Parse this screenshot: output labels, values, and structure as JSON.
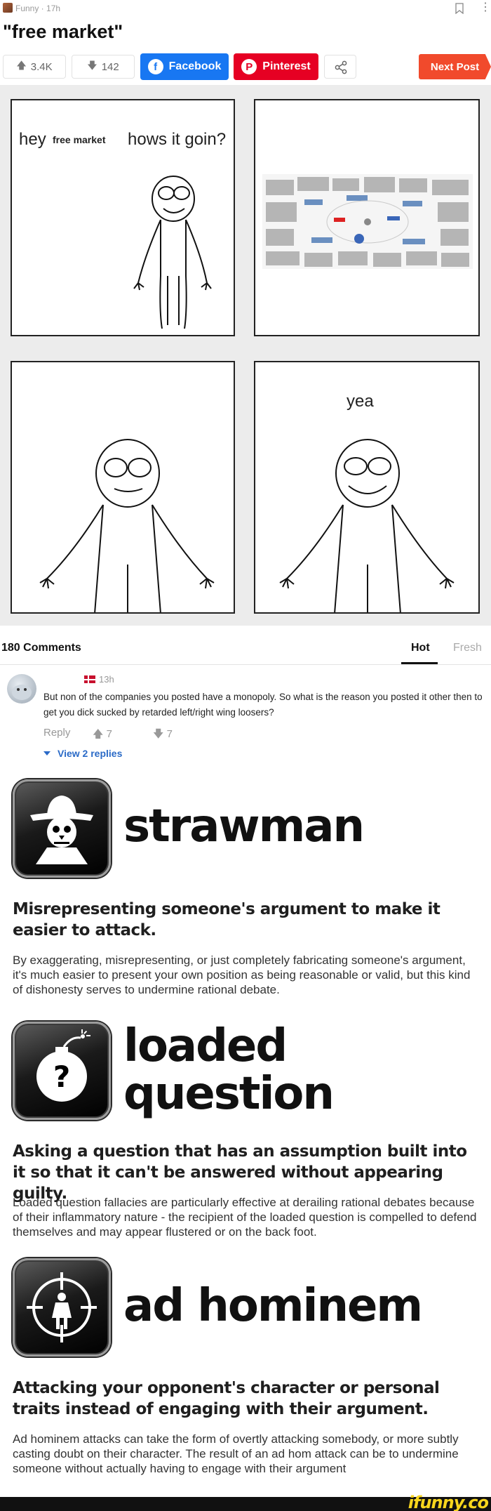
{
  "header": {
    "meta": "Funny · 17h",
    "title": "\"free market\""
  },
  "actions": {
    "upvotes": "3.4K",
    "downvotes": "142",
    "facebook": "Facebook",
    "pinterest": "Pinterest",
    "next_post": "Next Post",
    "colors": {
      "facebook": "#1877f2",
      "pinterest": "#e60023",
      "next": "#f14a2c"
    }
  },
  "comic": {
    "panel1_text_a": "hey",
    "panel1_text_b": "free market",
    "panel1_text_c": "hows it goin?",
    "panel4_text": "yea"
  },
  "comments": {
    "count_label": "180 Comments",
    "tab_hot": "Hot",
    "tab_fresh": "Fresh",
    "first": {
      "time": "13h",
      "text": "But non of the companies you posted have a monopoly. So what is the reason you posted it other then to get you dick sucked by retarded left/right wing loosers?",
      "reply": "Reply",
      "up": "7",
      "down": "7",
      "view_replies": "View 2 replies"
    }
  },
  "fallacies": [
    {
      "name": "strawman",
      "icon": "scarecrow-icon",
      "subtitle": "Misrepresenting someone's argument to make it easier to attack.",
      "description": "By exaggerating, misrepresenting, or just completely fabricating someone's argument, it's much easier to present your own position as being reasonable or valid, but this kind of dishonesty serves to undermine rational debate."
    },
    {
      "name_line1": "loaded",
      "name_line2": "question",
      "icon": "bomb-question-icon",
      "subtitle": "Asking a question that has an assumption built into it so that it can't be answered without appearing guilty.",
      "description": "Loaded question fallacies are particularly effective at derailing rational debates because of their inflammatory nature - the recipient of the loaded question is compelled to defend themselves and may appear flustered or on the back foot."
    },
    {
      "name": "ad hominem",
      "icon": "crosshair-person-icon",
      "subtitle": "Attacking your opponent's character or personal traits instead of engaging with their argument.",
      "description": "Ad hominem attacks can take the form of overtly attacking somebody, or more subtly casting doubt on their character. The result of an ad hom attack can be to undermine someone without actually having to engage with their argument"
    }
  ],
  "watermark": "ifunny.co"
}
